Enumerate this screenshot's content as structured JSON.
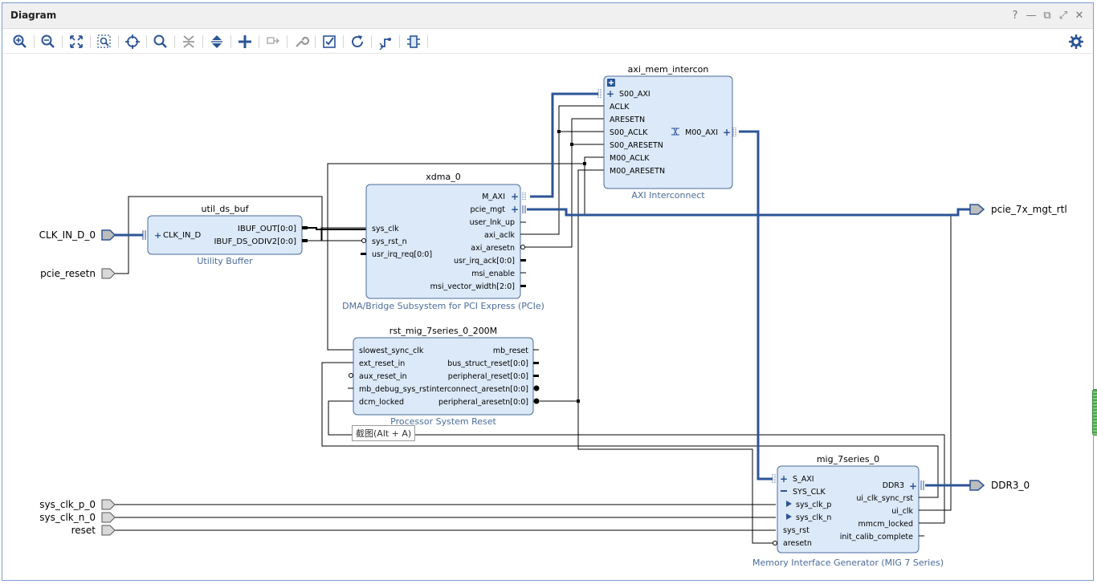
{
  "window": {
    "title": "Diagram",
    "controls": [
      "?",
      "—",
      "⧉",
      "⤢",
      "✕"
    ]
  },
  "toolbar": {
    "tools": [
      "zoom-in-icon",
      "zoom-out-icon",
      "zoom-fit-icon",
      "zoom-area-icon",
      "center-icon",
      "search-icon",
      "collapse-icon",
      "expand-icon",
      "add-ip-icon",
      "make-connection-icon",
      "properties-icon",
      "validate-icon",
      "refresh-icon",
      "optimize-routing-icon",
      "regenerate-layout-icon"
    ],
    "settings_icon": "gear-icon"
  },
  "colors": {
    "block_fill": "#dce9f8",
    "block_border": "#4a6c9b",
    "wire": "#000000",
    "bus": "#2c5597",
    "port": "#bdbdbd"
  },
  "tooltip": "截图(Alt + A)",
  "ext_ports": {
    "clk_in": "CLK_IN_D_0",
    "pcie_resetn": "pcie_resetn",
    "sys_clk_p": "sys_clk_p_0",
    "sys_clk_n": "sys_clk_n_0",
    "reset": "reset",
    "pcie_7x": "pcie_7x_mgt_rtl",
    "ddr3": "DDR3_0"
  },
  "blocks": {
    "util_ds_buf": {
      "name": "util_ds_buf",
      "subtitle": "Utility Buffer",
      "in": [
        "CLK_IN_D"
      ],
      "out": [
        "IBUF_OUT[0:0]",
        "IBUF_DS_ODIV2[0:0]"
      ]
    },
    "xdma": {
      "name": "xdma_0",
      "subtitle": "DMA/Bridge Subsystem for PCI Express (PCIe)",
      "in": [
        "sys_clk",
        "sys_rst_n",
        "usr_irq_req[0:0]"
      ],
      "out": [
        "M_AXI",
        "pcie_mgt",
        "user_lnk_up",
        "axi_aclk",
        "axi_aresetn",
        "usr_irq_ack[0:0]",
        "msi_enable",
        "msi_vector_width[2:0]"
      ]
    },
    "axi": {
      "name": "axi_mem_intercon",
      "subtitle": "AXI Interconnect",
      "in": [
        "S00_AXI",
        "ACLK",
        "ARESETN",
        "S00_ACLK",
        "S00_ARESETN",
        "M00_ACLK",
        "M00_ARESETN"
      ],
      "out": [
        "M00_AXI"
      ]
    },
    "rst": {
      "name": "rst_mig_7series_0_200M",
      "subtitle": "Processor System Reset",
      "in": [
        "slowest_sync_clk",
        "ext_reset_in",
        "aux_reset_in",
        "mb_debug_sys_rst",
        "dcm_locked"
      ],
      "out": [
        "mb_reset",
        "bus_struct_reset[0:0]",
        "peripheral_reset[0:0]",
        "interconnect_aresetn[0:0]",
        "peripheral_aresetn[0:0]"
      ]
    },
    "mig": {
      "name": "mig_7series_0",
      "subtitle": "Memory Interface Generator (MIG 7 Series)",
      "in": [
        "S_AXI",
        "SYS_CLK",
        "sys_clk_p",
        "sys_clk_n",
        "sys_rst",
        "aresetn"
      ],
      "out": [
        "DDR3",
        "ui_clk_sync_rst",
        "ui_clk",
        "mmcm_locked",
        "init_calib_complete"
      ]
    }
  }
}
